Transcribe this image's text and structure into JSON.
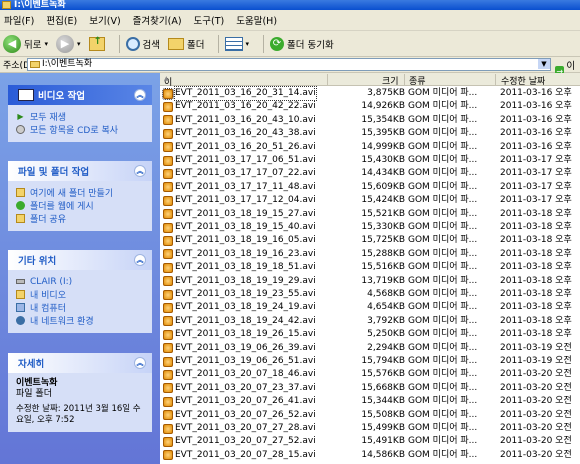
{
  "window": {
    "title": "I:\\이벤트녹화"
  },
  "menu": [
    "파일(F)",
    "편집(E)",
    "보기(V)",
    "즐겨찾기(A)",
    "도구(T)",
    "도움말(H)"
  ],
  "toolbar": {
    "back": "뒤로",
    "search": "검색",
    "folders": "폴더",
    "sync": "폴더 동기화"
  },
  "address": {
    "label": "주소(D)",
    "path": "I:\\이벤트녹화",
    "go": "이동"
  },
  "tasks": {
    "video": {
      "title": "비디오 작업",
      "items": [
        "모두 재생",
        "모든 항목을 CD로 복사"
      ]
    },
    "file": {
      "title": "파일 및 폴더 작업",
      "items": [
        "여기에 새 폴더 만들기",
        "폴더를 웹에 게시",
        "폴더 공유"
      ]
    },
    "places": {
      "title": "기타 위치",
      "items": [
        "CLAIR (I:)",
        "내 비디오",
        "내 컴퓨터",
        "내 네트워크 환경"
      ]
    },
    "details": {
      "title": "자세히",
      "name": "이벤트녹화",
      "type": "파일 폴더",
      "modified": "수정한 날짜: 2011년 3월 16일 수요일, 오후 7:52"
    }
  },
  "columns": {
    "name": "이름",
    "size": "크기",
    "type": "종류",
    "date": "수정한 날짜"
  },
  "files": [
    {
      "name": "EVT_2011_03_16_20_31_14.avi",
      "size": "3,875KB",
      "type": "GOM 미디어 파...",
      "date": "2011-03-16 오후"
    },
    {
      "name": "EVT_2011_03_16_20_42_22.avi",
      "size": "14,926KB",
      "type": "GOM 미디어 파...",
      "date": "2011-03-16 오후"
    },
    {
      "name": "EVT_2011_03_16_20_43_10.avi",
      "size": "15,354KB",
      "type": "GOM 미디어 파...",
      "date": "2011-03-16 오후"
    },
    {
      "name": "EVT_2011_03_16_20_43_38.avi",
      "size": "15,395KB",
      "type": "GOM 미디어 파...",
      "date": "2011-03-16 오후"
    },
    {
      "name": "EVT_2011_03_16_20_51_26.avi",
      "size": "14,999KB",
      "type": "GOM 미디어 파...",
      "date": "2011-03-16 오후"
    },
    {
      "name": "EVT_2011_03_17_17_06_51.avi",
      "size": "15,430KB",
      "type": "GOM 미디어 파...",
      "date": "2011-03-17 오후"
    },
    {
      "name": "EVT_2011_03_17_17_07_22.avi",
      "size": "14,434KB",
      "type": "GOM 미디어 파...",
      "date": "2011-03-17 오후"
    },
    {
      "name": "EVT_2011_03_17_17_11_48.avi",
      "size": "15,609KB",
      "type": "GOM 미디어 파...",
      "date": "2011-03-17 오후"
    },
    {
      "name": "EVT_2011_03_17_17_12_04.avi",
      "size": "15,424KB",
      "type": "GOM 미디어 파...",
      "date": "2011-03-17 오후"
    },
    {
      "name": "EVT_2011_03_18_19_15_27.avi",
      "size": "15,521KB",
      "type": "GOM 미디어 파...",
      "date": "2011-03-18 오후"
    },
    {
      "name": "EVT_2011_03_18_19_15_40.avi",
      "size": "15,330KB",
      "type": "GOM 미디어 파...",
      "date": "2011-03-18 오후"
    },
    {
      "name": "EVT_2011_03_18_19_16_05.avi",
      "size": "15,725KB",
      "type": "GOM 미디어 파...",
      "date": "2011-03-18 오후"
    },
    {
      "name": "EVT_2011_03_18_19_16_23.avi",
      "size": "15,288KB",
      "type": "GOM 미디어 파...",
      "date": "2011-03-18 오후"
    },
    {
      "name": "EVT_2011_03_18_19_18_51.avi",
      "size": "15,516KB",
      "type": "GOM 미디어 파...",
      "date": "2011-03-18 오후"
    },
    {
      "name": "EVT_2011_03_18_19_19_29.avi",
      "size": "13,719KB",
      "type": "GOM 미디어 파...",
      "date": "2011-03-18 오후"
    },
    {
      "name": "EVT_2011_03_18_19_23_55.avi",
      "size": "4,568KB",
      "type": "GOM 미디어 파...",
      "date": "2011-03-18 오후"
    },
    {
      "name": "EVT_2011_03_18_19_24_19.avi",
      "size": "4,654KB",
      "type": "GOM 미디어 파...",
      "date": "2011-03-18 오후"
    },
    {
      "name": "EVT_2011_03_18_19_24_42.avi",
      "size": "3,792KB",
      "type": "GOM 미디어 파...",
      "date": "2011-03-18 오후"
    },
    {
      "name": "EVT_2011_03_18_19_26_15.avi",
      "size": "5,250KB",
      "type": "GOM 미디어 파...",
      "date": "2011-03-18 오후"
    },
    {
      "name": "EVT_2011_03_19_06_26_39.avi",
      "size": "2,294KB",
      "type": "GOM 미디어 파...",
      "date": "2011-03-19 오전"
    },
    {
      "name": "EVT_2011_03_19_06_26_51.avi",
      "size": "15,794KB",
      "type": "GOM 미디어 파...",
      "date": "2011-03-19 오전"
    },
    {
      "name": "EVT_2011_03_20_07_18_46.avi",
      "size": "15,576KB",
      "type": "GOM 미디어 파...",
      "date": "2011-03-20 오전"
    },
    {
      "name": "EVT_2011_03_20_07_23_37.avi",
      "size": "15,668KB",
      "type": "GOM 미디어 파...",
      "date": "2011-03-20 오전"
    },
    {
      "name": "EVT_2011_03_20_07_26_41.avi",
      "size": "15,344KB",
      "type": "GOM 미디어 파...",
      "date": "2011-03-20 오전"
    },
    {
      "name": "EVT_2011_03_20_07_26_52.avi",
      "size": "15,508KB",
      "type": "GOM 미디어 파...",
      "date": "2011-03-20 오전"
    },
    {
      "name": "EVT_2011_03_20_07_27_28.avi",
      "size": "15,499KB",
      "type": "GOM 미디어 파...",
      "date": "2011-03-20 오전"
    },
    {
      "name": "EVT_2011_03_20_07_27_52.avi",
      "size": "15,491KB",
      "type": "GOM 미디어 파...",
      "date": "2011-03-20 오전"
    },
    {
      "name": "EVT_2011_03_20_07_28_15.avi",
      "size": "14,586KB",
      "type": "GOM 미디어 파...",
      "date": "2011-03-20 오전"
    }
  ]
}
